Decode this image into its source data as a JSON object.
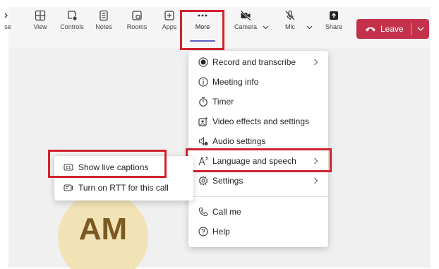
{
  "toolbar": {
    "items": [
      {
        "label": "se",
        "icon": "partial-icon"
      },
      {
        "label": "View",
        "icon": "grid-icon"
      },
      {
        "label": "Controls",
        "icon": "controls-icon"
      },
      {
        "label": "Notes",
        "icon": "notes-icon"
      },
      {
        "label": "Rooms",
        "icon": "rooms-icon"
      },
      {
        "label": "Apps",
        "icon": "apps-plus-icon"
      },
      {
        "label": "More",
        "icon": "more-ellipsis-icon",
        "active": true
      },
      {
        "label": "Camera",
        "icon": "camera-off-icon"
      },
      {
        "label": "Mic",
        "icon": "mic-off-icon"
      },
      {
        "label": "Share",
        "icon": "share-icon"
      }
    ],
    "leave_label": "Leave"
  },
  "more_menu": {
    "items": [
      {
        "label": "Record and transcribe",
        "icon": "record-icon",
        "submenu": true
      },
      {
        "label": "Meeting info",
        "icon": "info-icon",
        "submenu": false
      },
      {
        "label": "Timer",
        "icon": "timer-icon",
        "submenu": false
      },
      {
        "label": "Video effects and settings",
        "icon": "video-effects-icon",
        "submenu": false
      },
      {
        "label": "Audio settings",
        "icon": "audio-settings-icon",
        "submenu": false
      },
      {
        "label": "Language and speech",
        "icon": "language-icon",
        "submenu": true,
        "highlighted": true
      },
      {
        "label": "Settings",
        "icon": "settings-gear-icon",
        "submenu": true
      },
      {
        "label": "Call me",
        "icon": "phone-icon",
        "submenu": false
      },
      {
        "label": "Help",
        "icon": "help-icon",
        "submenu": false
      }
    ]
  },
  "language_submenu": {
    "items": [
      {
        "label": "Show live captions",
        "icon": "cc-icon",
        "highlighted": true
      },
      {
        "label": "Turn on RTT for this call",
        "icon": "rtt-icon"
      }
    ]
  },
  "avatar": {
    "initials": "AM",
    "color": "#f1e3b6"
  },
  "colors": {
    "leave": "#c4314b",
    "accent": "#5b5fc7",
    "highlight_box": "#d0232f"
  }
}
